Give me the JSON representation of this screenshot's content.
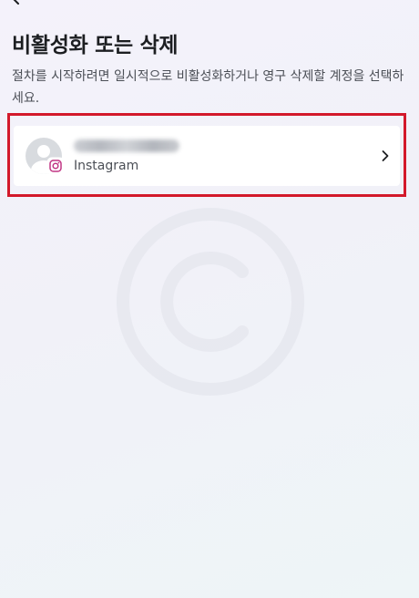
{
  "page": {
    "title": "비활성화 또는 삭제",
    "description": "절차를 시작하려면 일시적으로 비활성화하거나 영구 삭제할 계정을 선택하세요."
  },
  "account": {
    "username": "••••••••••••",
    "platform": "Instagram"
  },
  "colors": {
    "highlight_border": "#d3192b",
    "card_background": "#ffffff",
    "instagram_icon": "#c13584",
    "text_primary": "#1c1e21",
    "text_secondary": "#4b4f56"
  },
  "icons": {
    "back": "arrow-left-icon",
    "avatar": "default-avatar-icon",
    "platform": "instagram-icon",
    "open": "chevron-right-icon",
    "watermark": "copyright-watermark-icon"
  }
}
